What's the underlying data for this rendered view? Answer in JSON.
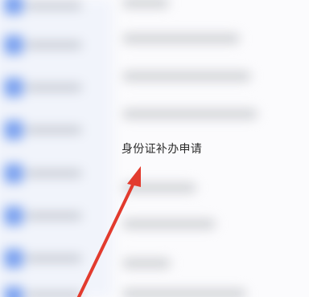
{
  "menu": {
    "focused_item_label": "身份证补办申请"
  },
  "annotation": {
    "arrow_color": "#e23b2e"
  }
}
